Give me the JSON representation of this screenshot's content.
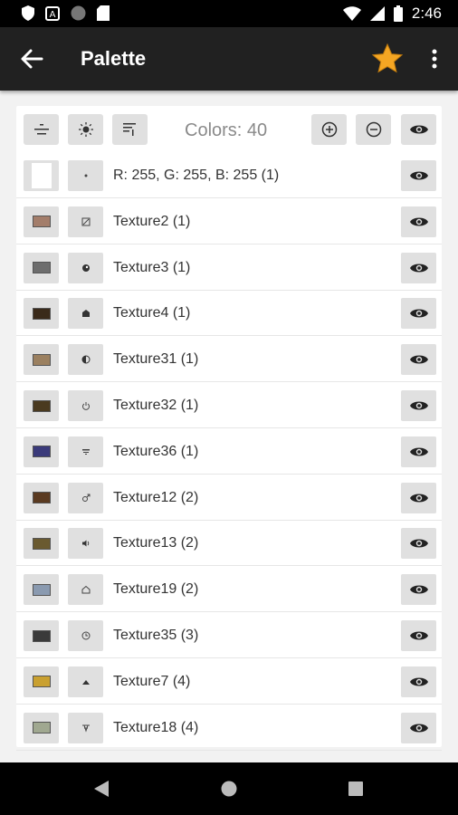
{
  "status_bar": {
    "time": "2:46"
  },
  "app_bar": {
    "title": "Palette"
  },
  "toolbar": {
    "colors_label": "Colors: 40"
  },
  "colors": {
    "accent_star": "#f5a623",
    "app_bar_bg": "#212121",
    "button_bg": "#e0e0e0"
  },
  "rows": [
    {
      "label": "R: 255, G: 255, B: 255 (1)",
      "swatch_color": "#ffffff",
      "mark": "dot"
    },
    {
      "label": "Texture2 (1)",
      "swatch_color": "#a37d6a",
      "mark": "slash-square"
    },
    {
      "label": "Texture3 (1)",
      "swatch_color": "#6d6d6d",
      "mark": "filled-circle"
    },
    {
      "label": "Texture4 (1)",
      "swatch_color": "#3a2a1a",
      "mark": "house"
    },
    {
      "label": "Texture31 (1)",
      "swatch_color": "#9b8060",
      "mark": "half-circle"
    },
    {
      "label": "Texture32 (1)",
      "swatch_color": "#4a3a20",
      "mark": "power"
    },
    {
      "label": "Texture36 (1)",
      "swatch_color": "#3a3a7a",
      "mark": "lines"
    },
    {
      "label": "Texture12 (2)",
      "swatch_color": "#5a3a20",
      "mark": "male"
    },
    {
      "label": "Texture13 (2)",
      "swatch_color": "#6a5a30",
      "mark": "volume"
    },
    {
      "label": "Texture19 (2)",
      "swatch_color": "#8a9ab0",
      "mark": "home"
    },
    {
      "label": "Texture35 (3)",
      "swatch_color": "#3a3a3a",
      "mark": "clock"
    },
    {
      "label": "Texture7 (4)",
      "swatch_color": "#c9a030",
      "mark": "triangle"
    },
    {
      "label": "Texture18 (4)",
      "swatch_color": "#a0a890",
      "mark": "glyph"
    }
  ]
}
